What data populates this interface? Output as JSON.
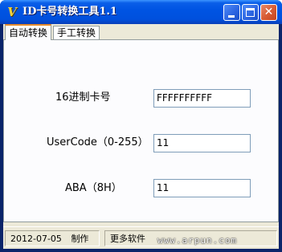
{
  "window": {
    "title": "ID卡号转换工具1.1",
    "icon": "app-v-logo-icon",
    "buttons": {
      "minimize": "minimize-icon",
      "maximize": "maximize-icon",
      "close": "close-icon",
      "close_glyph": "✕"
    }
  },
  "tabs": [
    {
      "label": "自动转换",
      "active": true
    },
    {
      "label": "手工转换",
      "active": false
    }
  ],
  "form": {
    "hex_card_label": "16进制卡号",
    "hex_card_value": "FFFFFFFFFF",
    "usercode_label": "UserCode（0-255）",
    "usercode_value": "11",
    "aba_label": "ABA（8H）",
    "aba_value": "11"
  },
  "status": {
    "date": "2012-07-05",
    "made": "制作",
    "more": "更多软件"
  },
  "watermark": "www.arpun.com",
  "colors": {
    "title_bar": "#0054e3",
    "client_bg": "#ece9d8",
    "tab_accent": "#e68b2c",
    "close_button": "#d75a32"
  }
}
